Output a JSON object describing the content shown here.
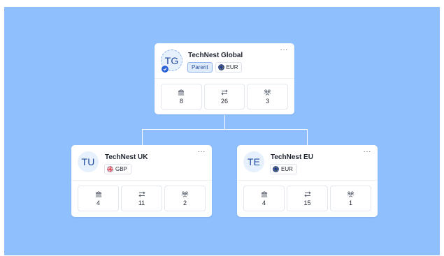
{
  "colors": {
    "canvas": "#8fc0fd",
    "card": "#ffffff",
    "accent": "#2d62d6",
    "avatar_bg": "#e7f0fd"
  },
  "parent": {
    "initials": "TG",
    "name": "TechNest Global",
    "role_tag": "Parent",
    "currency": "EUR",
    "currency_flag": "eu-flag-icon",
    "menu": "···",
    "stats": [
      {
        "icon": "bank-icon",
        "value": "8"
      },
      {
        "icon": "transfer-arrows-icon",
        "value": "26"
      },
      {
        "icon": "users-icon",
        "value": "3"
      }
    ]
  },
  "children": [
    {
      "initials": "TU",
      "name": "TechNest UK",
      "currency": "GBP",
      "currency_flag": "uk-flag-icon",
      "menu": "···",
      "stats": [
        {
          "icon": "bank-icon",
          "value": "4"
        },
        {
          "icon": "transfer-arrows-icon",
          "value": "11"
        },
        {
          "icon": "users-icon",
          "value": "2"
        }
      ]
    },
    {
      "initials": "TE",
      "name": "TechNest EU",
      "currency": "EUR",
      "currency_flag": "eu-flag-icon",
      "menu": "···",
      "stats": [
        {
          "icon": "bank-icon",
          "value": "4"
        },
        {
          "icon": "transfer-arrows-icon",
          "value": "15"
        },
        {
          "icon": "users-icon",
          "value": "1"
        }
      ]
    }
  ]
}
